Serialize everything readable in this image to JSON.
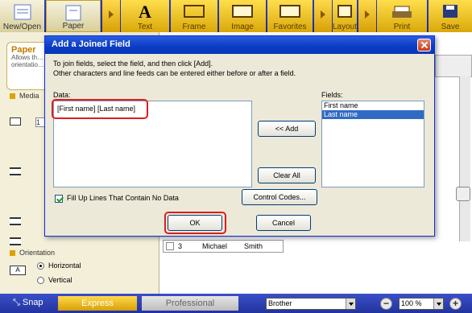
{
  "toolbar": {
    "items": [
      {
        "label": "New/Open",
        "icon": "folder-icon"
      },
      {
        "label": "Paper",
        "icon": "paper-icon"
      },
      {
        "label": "Text",
        "icon": "text-icon"
      },
      {
        "label": "Frame",
        "icon": "frame-icon"
      },
      {
        "label": "Image",
        "icon": "image-icon"
      },
      {
        "label": "Favorites",
        "icon": "favorites-icon"
      },
      {
        "label": "Layout",
        "icon": "layout-icon"
      },
      {
        "label": "Print",
        "icon": "printer-icon"
      },
      {
        "label": "Save",
        "icon": "save-icon"
      }
    ]
  },
  "left_panel": {
    "paper_tab_title": "Paper",
    "paper_tab_desc": "Allows th… orientatio…",
    "media_label": "Media",
    "orientation_label": "Orientation",
    "horizontal_label": "Horizontal",
    "vertical_label": "Vertical",
    "num_1": "1"
  },
  "background_table": {
    "row_num": "3",
    "first": "Michael",
    "last": "Smith"
  },
  "dialog": {
    "title": "Add a Joined Field",
    "instruction_line1": "To join fields, select the field, and then click [Add].",
    "instruction_line2": "Other characters and line feeds can be entered either before or after a field.",
    "data_label": "Data:",
    "data_value": "[First name] [Last name]",
    "fields_label": "Fields:",
    "fields": [
      "First name",
      "Last name"
    ],
    "selected_field": "Last name",
    "add_button": "<< Add",
    "clear_all_button": "Clear All",
    "fill_up_label": "Fill Up Lines That Contain No Data",
    "fill_up_checked": true,
    "control_codes_button": "Control Codes...",
    "ok_button": "OK",
    "cancel_button": "Cancel"
  },
  "statusbar": {
    "snap_label": "Snap",
    "express_label": "Express",
    "professional_label": "Professional",
    "printer_value": "Brother",
    "zoom_value": "100 %",
    "zoom_out": "−",
    "zoom_in": "+"
  },
  "colors": {
    "accent": "#2a3fc0",
    "highlight": "#e01c1c",
    "express": "#d6a008"
  }
}
